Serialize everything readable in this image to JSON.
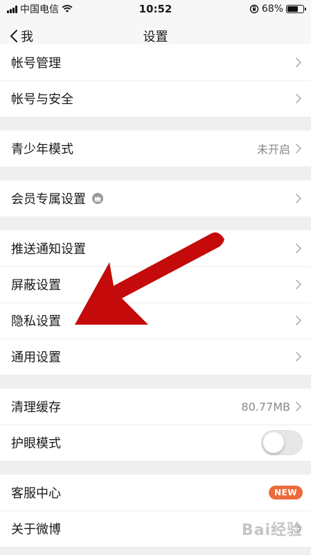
{
  "status_bar": {
    "carrier": "中国电信",
    "time": "10:52",
    "battery_percent": "68%",
    "battery_level": 0.68
  },
  "nav": {
    "back_label": "我",
    "title": "设置"
  },
  "groups": [
    [
      {
        "label": "帐号管理"
      },
      {
        "label": "帐号与安全"
      }
    ],
    [
      {
        "label": "青少年模式",
        "value": "未开启"
      }
    ],
    [
      {
        "label": "会员专属设置",
        "icon": "crown-icon"
      }
    ],
    [
      {
        "label": "推送通知设置"
      },
      {
        "label": "屏蔽设置"
      },
      {
        "label": "隐私设置"
      },
      {
        "label": "通用设置"
      }
    ],
    [
      {
        "label": "清理缓存",
        "value": "80.77MB"
      },
      {
        "label": "护眼模式",
        "toggle": false
      }
    ],
    [
      {
        "label": "客服中心",
        "badge": "NEW"
      },
      {
        "label": "关于微博"
      }
    ]
  ],
  "colors": {
    "badge": "#ee6a3b",
    "annotation_arrow": "#c40a0a"
  },
  "watermark": "Bai经验"
}
